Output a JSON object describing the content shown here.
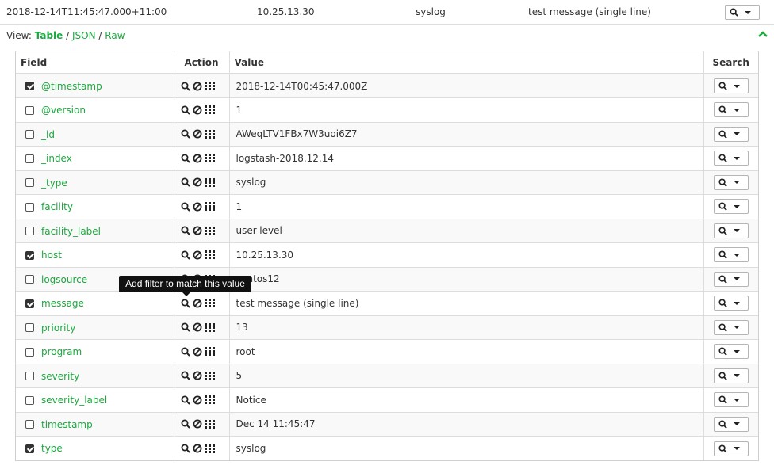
{
  "summary_row": {
    "timestamp": "2018-12-14T11:45:47.000+11:00",
    "host": "10.25.13.30",
    "type": "syslog",
    "message": "test message (single line)"
  },
  "view": {
    "label": "View:",
    "sep": "/",
    "options": [
      "Table",
      "JSON",
      "Raw"
    ],
    "active": "Table"
  },
  "table": {
    "headers": {
      "field": "Field",
      "action": "Action",
      "value": "Value",
      "search": "Search"
    },
    "rows": [
      {
        "field": "@timestamp",
        "value": "2018-12-14T00:45:47.000Z",
        "checked": true
      },
      {
        "field": "@version",
        "value": "1",
        "checked": false
      },
      {
        "field": "_id",
        "value": "AWeqLTV1FBx7W3uoi6Z7",
        "checked": false
      },
      {
        "field": "_index",
        "value": "logstash-2018.12.14",
        "checked": false
      },
      {
        "field": "_type",
        "value": "syslog",
        "checked": false
      },
      {
        "field": "facility",
        "value": "1",
        "checked": false
      },
      {
        "field": "facility_label",
        "value": "user-level",
        "checked": false
      },
      {
        "field": "host",
        "value": "10.25.13.30",
        "checked": true
      },
      {
        "field": "logsource",
        "value": "centos12",
        "checked": false
      },
      {
        "field": "message",
        "value": "test message (single line)",
        "checked": true
      },
      {
        "field": "priority",
        "value": "13",
        "checked": false
      },
      {
        "field": "program",
        "value": "root",
        "checked": false
      },
      {
        "field": "severity",
        "value": "5",
        "checked": false
      },
      {
        "field": "severity_label",
        "value": "Notice",
        "checked": false
      },
      {
        "field": "timestamp",
        "value": "Dec 14 11:45:47",
        "checked": false
      },
      {
        "field": "type",
        "value": "syslog",
        "checked": true
      }
    ]
  },
  "tooltip": {
    "text": "Add filter to match this value"
  },
  "icons": {
    "search": "search-icon",
    "exclude": "ban-icon",
    "toggle": "table-icon",
    "caret": "caret-down-icon",
    "collapse": "chevron-up-icon"
  },
  "colors": {
    "accent": "#1ba93e",
    "tooltip_bg": "#111111"
  }
}
